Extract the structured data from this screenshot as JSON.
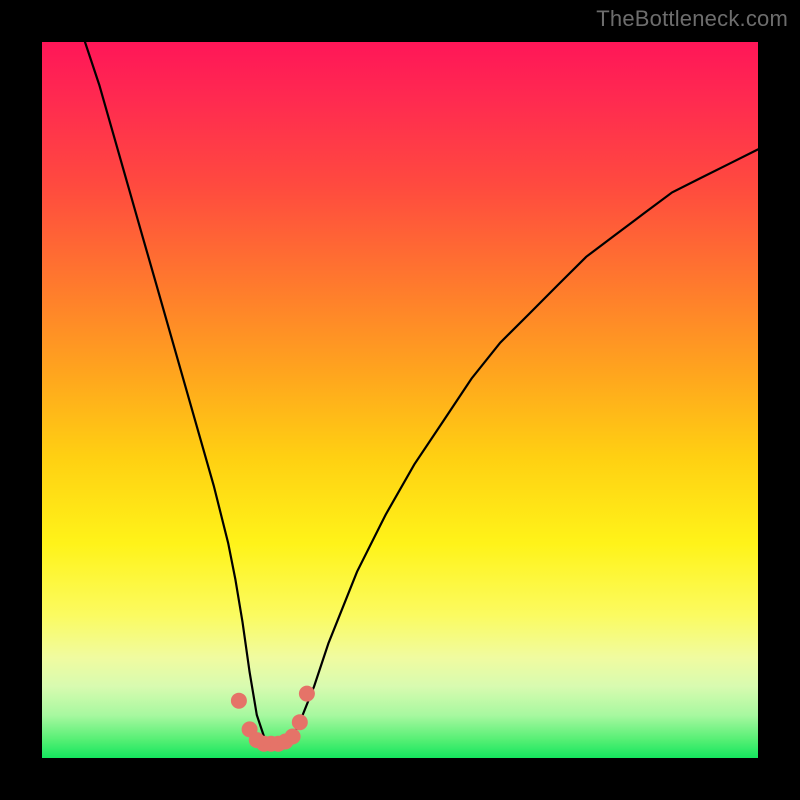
{
  "watermark": {
    "text": "TheBottleneck.com"
  },
  "chart_data": {
    "type": "line",
    "title": "",
    "xlabel": "",
    "ylabel": "",
    "xlim": [
      0,
      100
    ],
    "ylim": [
      0,
      100
    ],
    "series": [
      {
        "name": "bottleneck-curve",
        "x": [
          6,
          8,
          10,
          12,
          14,
          16,
          18,
          20,
          22,
          24,
          26,
          27,
          28,
          29,
          30,
          31,
          32,
          33,
          34,
          35,
          36,
          38,
          40,
          44,
          48,
          52,
          56,
          60,
          64,
          68,
          72,
          76,
          80,
          84,
          88,
          92,
          96,
          100
        ],
        "y": [
          100,
          94,
          87,
          80,
          73,
          66,
          59,
          52,
          45,
          38,
          30,
          25,
          19,
          12,
          6,
          3,
          2,
          2,
          2,
          3,
          5,
          10,
          16,
          26,
          34,
          41,
          47,
          53,
          58,
          62,
          66,
          70,
          73,
          76,
          79,
          81,
          83,
          85
        ]
      }
    ],
    "markers": {
      "name": "valley-dots",
      "x": [
        27.5,
        29,
        30,
        31,
        32,
        33,
        34,
        35,
        36,
        37
      ],
      "y": [
        8,
        4,
        2.5,
        2,
        2,
        2,
        2.3,
        3,
        5,
        9
      ],
      "color": "#e57368",
      "radius_px": 8
    },
    "background_gradient": {
      "top": "#ff1658",
      "upper_mid": "#ffa41e",
      "mid": "#fff319",
      "lower": "#a8f8a0",
      "bottom": "#14e65e"
    }
  }
}
